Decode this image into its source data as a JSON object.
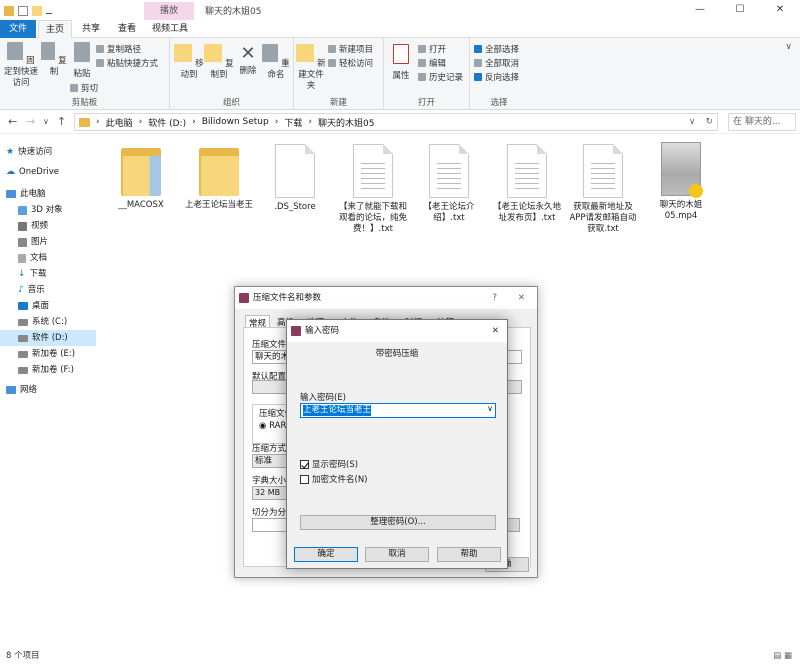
{
  "window": {
    "title": "聊天的木姐05",
    "context_tab": "播放",
    "minimize": "—",
    "maximize": "☐",
    "close": "✕"
  },
  "ribbon_tabs": [
    "文件",
    "主页",
    "共享",
    "查看",
    "视频工具"
  ],
  "ribbon": {
    "clipboard": {
      "pin": "固定到快速访问",
      "copy": "复制",
      "paste": "粘贴",
      "copy_path": "复制路径",
      "paste_shortcut": "粘贴快捷方式",
      "cut": "剪切",
      "label": "剪贴板"
    },
    "organize": {
      "move_to": "移动到",
      "copy_to": "复制到",
      "delete": "删除",
      "rename": "重命名",
      "label": "组织"
    },
    "new": {
      "new_folder": "新建文件夹",
      "new_item": "新建项目",
      "easy_access": "轻松访问",
      "label": "新建"
    },
    "open": {
      "properties": "属性",
      "open": "打开",
      "edit": "编辑",
      "history": "历史记录",
      "label": "打开"
    },
    "select": {
      "select_all": "全部选择",
      "select_none": "全部取消",
      "invert": "反向选择",
      "label": "选择"
    }
  },
  "nav": {
    "back": "←",
    "forward": "→",
    "recent": "∨",
    "up": "↑",
    "breadcrumb": [
      "此电脑",
      "软件 (D:)",
      "Bilidown Setup",
      "下载",
      "聊天的木姐05"
    ],
    "search_placeholder": "在 聊天的..."
  },
  "sidebar": [
    {
      "label": "快速访问"
    },
    {
      "label": "OneDrive"
    },
    {
      "label": "此电脑"
    },
    {
      "label": "3D 对象"
    },
    {
      "label": "视频"
    },
    {
      "label": "图片"
    },
    {
      "label": "文档"
    },
    {
      "label": "下载"
    },
    {
      "label": "音乐"
    },
    {
      "label": "桌面"
    },
    {
      "label": "系统 (C:)"
    },
    {
      "label": "软件 (D:)"
    },
    {
      "label": "新加卷 (E:)"
    },
    {
      "label": "新加卷 (F:)"
    },
    {
      "label": "网络"
    }
  ],
  "files": [
    {
      "name": "__MACOSX",
      "kind": "folder"
    },
    {
      "name": "上老王论坛当老王",
      "kind": "folder"
    },
    {
      "name": ".DS_Store",
      "kind": "blank"
    },
    {
      "name": "【来了就能下载和观看的论坛，纯免费！】.txt",
      "kind": "text"
    },
    {
      "name": "【老王论坛介绍】.txt",
      "kind": "text"
    },
    {
      "name": "【老王论坛永久地址发布页】.txt",
      "kind": "text"
    },
    {
      "name": "获取最新地址及APP请发邮箱自动获取.txt",
      "kind": "text"
    },
    {
      "name": "聊天的木姐05.mp4",
      "kind": "video"
    }
  ],
  "status": {
    "count": "8 个项目"
  },
  "archive_dialog": {
    "title": "压缩文件名和参数",
    "help": "?",
    "close": "✕",
    "tabs": [
      "常规",
      "高级",
      "选项",
      "文件",
      "备份",
      "时间",
      "注释"
    ],
    "archive_name_label": "压缩文件名",
    "archive_name_value": "聊天的木",
    "default_profile": "默认配置",
    "format_label": "压缩文件格式",
    "format_rar": "RAR",
    "method_label": "压缩方式",
    "method_value": "标准",
    "dict_label": "字典大小",
    "dict_value": "32 MB",
    "split_label": "切分为分卷",
    "ok_partial": "确"
  },
  "password_dialog": {
    "title": "输入密码",
    "close": "✕",
    "heading": "带密码压缩",
    "password_label": "输入密码(E)",
    "password_value": "上老王论坛当老王",
    "show_password": "显示密码(S)",
    "encrypt_names": "加密文件名(N)",
    "organize": "整理密码(O)...",
    "ok": "确定",
    "cancel": "取消",
    "help": "帮助"
  },
  "colors": {
    "accent": "#1979ca",
    "context_tab": "#f6d6ea",
    "folder": "#f7d67c",
    "selection": "#cce8ff",
    "input_selection": "#0078d7"
  }
}
